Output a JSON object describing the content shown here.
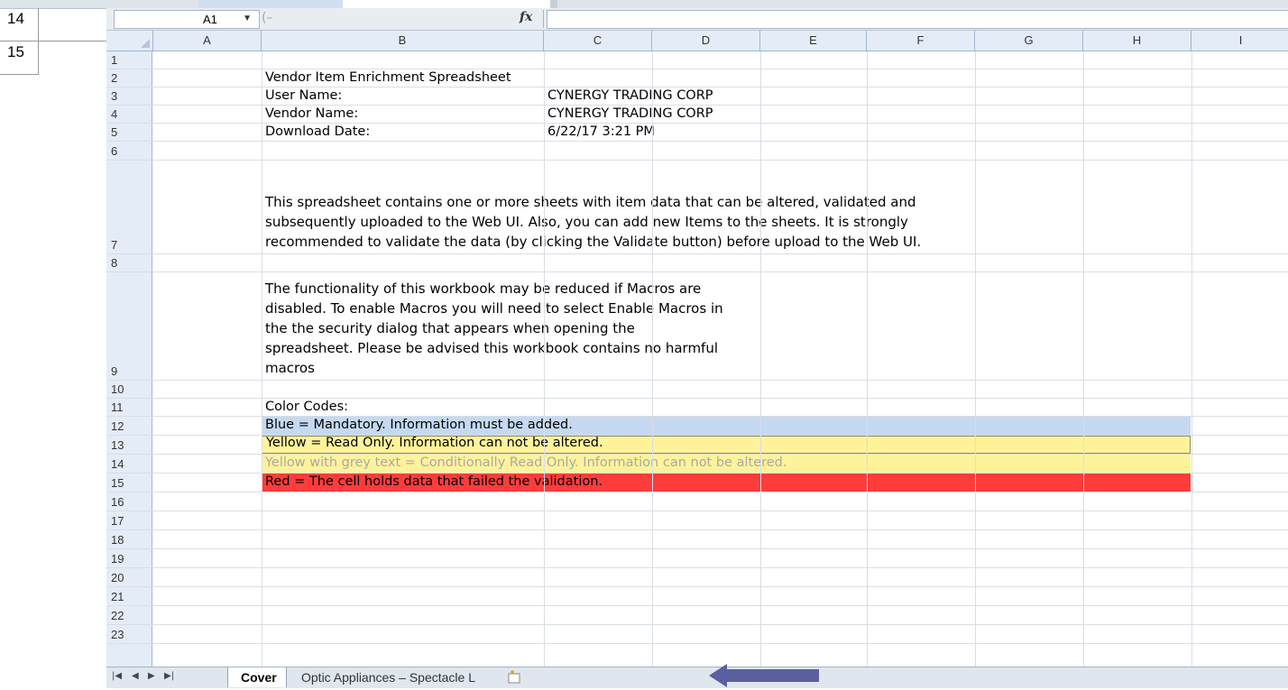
{
  "outer_rows": [
    {
      "label": "14"
    },
    {
      "label": "15"
    }
  ],
  "name_box": {
    "value": "A1"
  },
  "formula": {
    "fx_label": "fx",
    "content": ""
  },
  "columns": [
    "A",
    "B",
    "C",
    "D",
    "E",
    "F",
    "G",
    "H",
    "I"
  ],
  "row_numbers": [
    "1",
    "2",
    "3",
    "4",
    "5",
    "6",
    "7",
    "8",
    "9",
    "10",
    "11",
    "12",
    "13",
    "14",
    "15",
    "16",
    "17",
    "18",
    "19",
    "20",
    "21",
    "22",
    "23"
  ],
  "cells": {
    "b2": "Vendor Item Enrichment Spreadsheet",
    "b3": "User Name:",
    "c3": "CYNERGY TRADING CORP",
    "b4": "Vendor Name:",
    "c4": "CYNERGY TRADING CORP",
    "b5": "Download Date:",
    "c5": "6/22/17 3:21 PM",
    "b7_line1": "This spreadsheet contains one or more sheets with item data that can be altered, validated and",
    "b7_line2": "subsequently uploaded to the Web UI. Also, you can add new Items to the sheets. It is strongly",
    "b7_line3": "recommended to validate the data (by clicking the Validate button) before upload to the Web UI.",
    "b9_line1": "The functionality of this workbook may be reduced if Macros are",
    "b9_line2": "disabled. To enable Macros you will need to select Enable Macros in",
    "b9_line3": "the  the security dialog that appears when opening the",
    "b9_line4": "spreadsheet. Please be advised this workbook contains no harmful",
    "b9_line5": "macros",
    "b11": "Color Codes:",
    "b12": "Blue = Mandatory. Information must be added.",
    "b13": "Yellow = Read Only. Information can not be altered.",
    "b14": "Yellow with grey text = Conditionally Read Only. Information can not be altered.",
    "b15": "Red = The cell holds data that failed the validation."
  },
  "colors": {
    "blue": "#c5d9f1",
    "yellow": "#fff39a",
    "red": "#ff3c3c",
    "grey_text": "#a8a8a8",
    "arrow": "#5b5fa0"
  },
  "sheet_tabs": {
    "nav": [
      "|◀",
      "◀",
      "▶",
      "▶|"
    ],
    "active": "Cover",
    "inactive": "Optic Appliances – Spectacle L",
    "new_sheet_icon": "insert-sheet-icon"
  }
}
